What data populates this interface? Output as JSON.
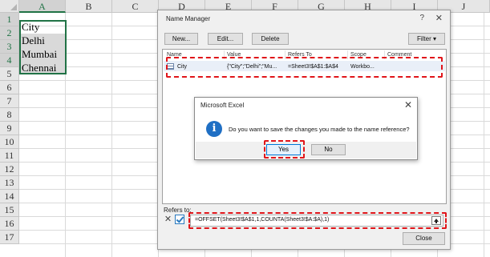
{
  "sheet": {
    "columns": [
      "A",
      "B",
      "C",
      "D",
      "E",
      "F",
      "G",
      "H",
      "I",
      "J"
    ],
    "rows": [
      "1",
      "2",
      "3",
      "4",
      "5",
      "6",
      "7",
      "8",
      "9",
      "10",
      "11",
      "12",
      "13",
      "14",
      "15",
      "16",
      "17"
    ],
    "cells": {
      "a1": "City",
      "a2": "Delhi",
      "a3": "Mumbai",
      "a4": "Chennai"
    }
  },
  "name_manager": {
    "title": "Name Manager",
    "help_glyph": "?",
    "close_glyph": "✕",
    "buttons": {
      "new": "New...",
      "edit": "Edit...",
      "delete": "Delete",
      "filter": "Filter"
    },
    "list_headers": {
      "name": "Name",
      "value": "Value",
      "refers_to": "Refers To",
      "scope": "Scope",
      "comment": "Comment"
    },
    "rows": [
      {
        "name": "City",
        "value": "{\"City\";\"Delhi\";\"Mu...",
        "refers_to": "=Sheet3!$A$1:$A$4",
        "scope": "Workbo...",
        "comment": ""
      }
    ],
    "refers_to_label": "Refers to:",
    "refers_to_value": "=OFFSET(Sheet3!$A$1,1,COUNTA(Sheet3!$A:$A),1)",
    "close_label": "Close"
  },
  "message_box": {
    "title": "Microsoft Excel",
    "close_glyph": "✕",
    "message": "Do you want to save the changes you made to the name reference?",
    "yes_label": "Yes",
    "no_label": "No",
    "icon": "info-icon"
  },
  "colors": {
    "accent_green": "#217346",
    "highlight_red": "#e0151a",
    "info_blue": "#1f6fc4"
  }
}
